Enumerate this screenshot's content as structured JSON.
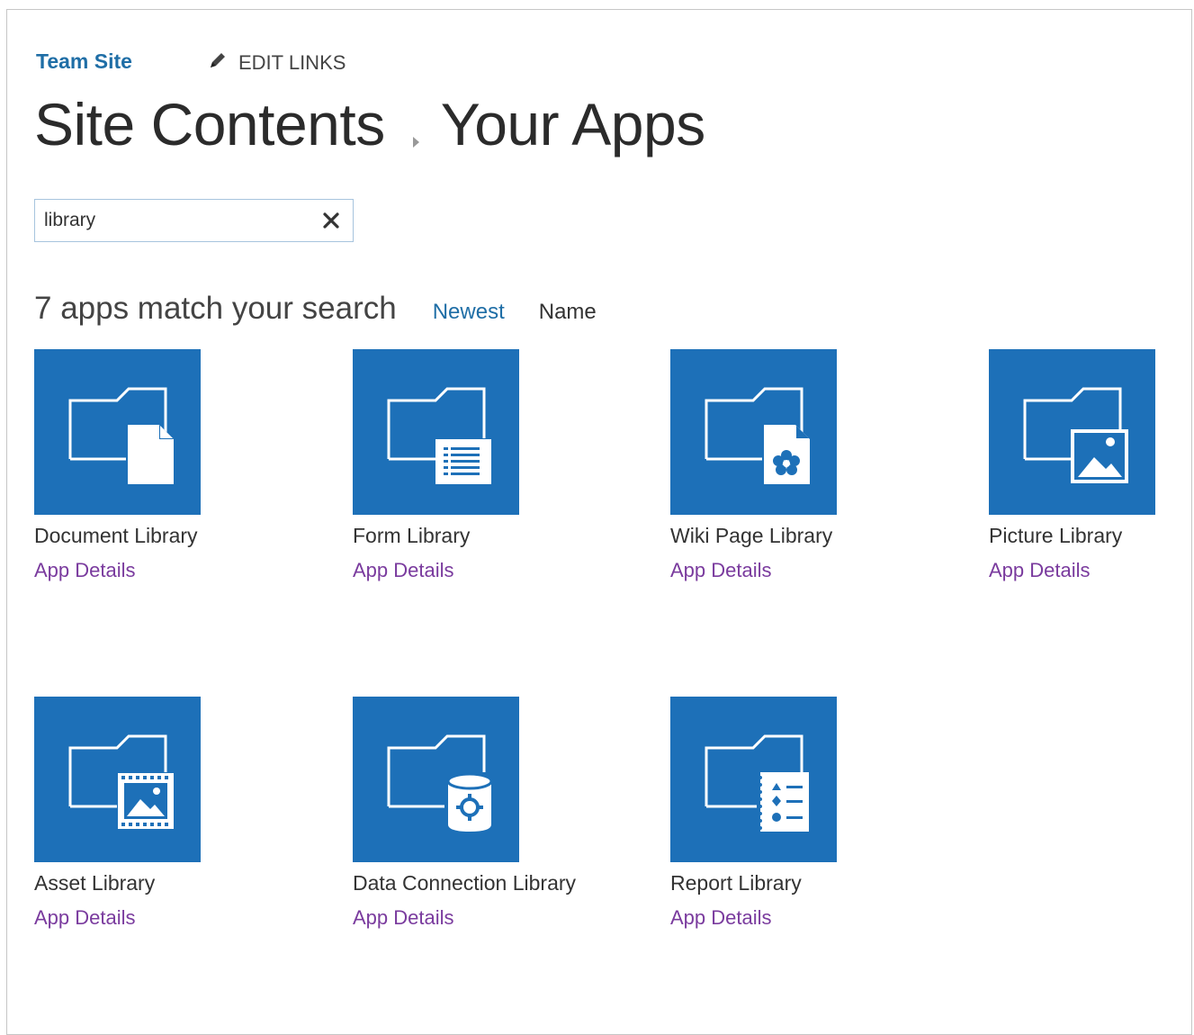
{
  "header": {
    "site_link": "Team Site",
    "edit_links_label": "EDIT LINKS",
    "breadcrumb": {
      "parent": "Site Contents",
      "current": "Your Apps"
    }
  },
  "search": {
    "value": "library",
    "clear_icon": "close-icon"
  },
  "results": {
    "summary": "7 apps match your search",
    "sort_options": [
      "Newest",
      "Name"
    ],
    "active_sort": "Newest"
  },
  "apps": [
    {
      "title": "Document Library",
      "details_link": "App Details",
      "icon": "document-library-icon"
    },
    {
      "title": "Form Library",
      "details_link": "App Details",
      "icon": "form-library-icon"
    },
    {
      "title": "Wiki Page Library",
      "details_link": "App Details",
      "icon": "wiki-page-library-icon"
    },
    {
      "title": "Picture Library",
      "details_link": "App Details",
      "icon": "picture-library-icon"
    },
    {
      "title": "Asset Library",
      "details_link": "App Details",
      "icon": "asset-library-icon"
    },
    {
      "title": "Data Connection Library",
      "details_link": "App Details",
      "icon": "data-connection-library-icon"
    },
    {
      "title": "Report Library",
      "details_link": "App Details",
      "icon": "report-library-icon"
    }
  ],
  "colors": {
    "tile_background": "#1d70b8",
    "link_blue": "#1f6ea6",
    "details_purple": "#7a3b9e"
  }
}
